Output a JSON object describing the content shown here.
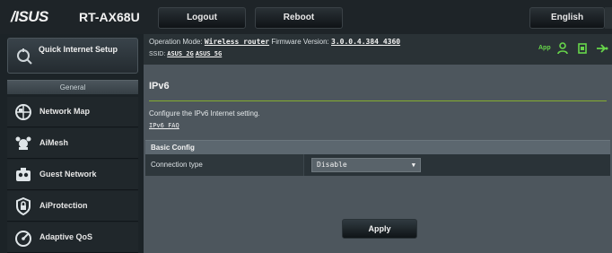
{
  "brand": {
    "logo": "/ISUS",
    "model": "RT-AX68U"
  },
  "topbar": {
    "logout": "Logout",
    "reboot": "Reboot",
    "language": "English"
  },
  "sidebar": {
    "quick_setup": "Quick Internet Setup",
    "section": "General",
    "items": [
      {
        "label": "Network Map",
        "icon": "network-map-icon"
      },
      {
        "label": "AiMesh",
        "icon": "aimesh-icon"
      },
      {
        "label": "Guest Network",
        "icon": "guest-network-icon"
      },
      {
        "label": "AiProtection",
        "icon": "aiprotection-icon"
      },
      {
        "label": "Adaptive QoS",
        "icon": "adaptive-qos-icon"
      }
    ]
  },
  "info": {
    "op_mode_label": "Operation Mode:",
    "op_mode_value": "Wireless router",
    "fw_label": "Firmware Version:",
    "fw_value": "3.0.0.4.384_4360",
    "ssid_label": "SSID:",
    "ssid_1": "ASUS_2G",
    "ssid_2": "ASUS_5G",
    "app_label": "App"
  },
  "page": {
    "title": "IPv6",
    "description": "Configure the IPv6 Internet setting.",
    "faq": "IPv6_FAQ",
    "section": "Basic Config",
    "connection_type_label": "Connection type",
    "connection_type_value": "Disable",
    "apply": "Apply"
  },
  "colors": {
    "accent_green": "#85ad2f",
    "app_green": "#67d64a",
    "background": "#1c2327"
  }
}
